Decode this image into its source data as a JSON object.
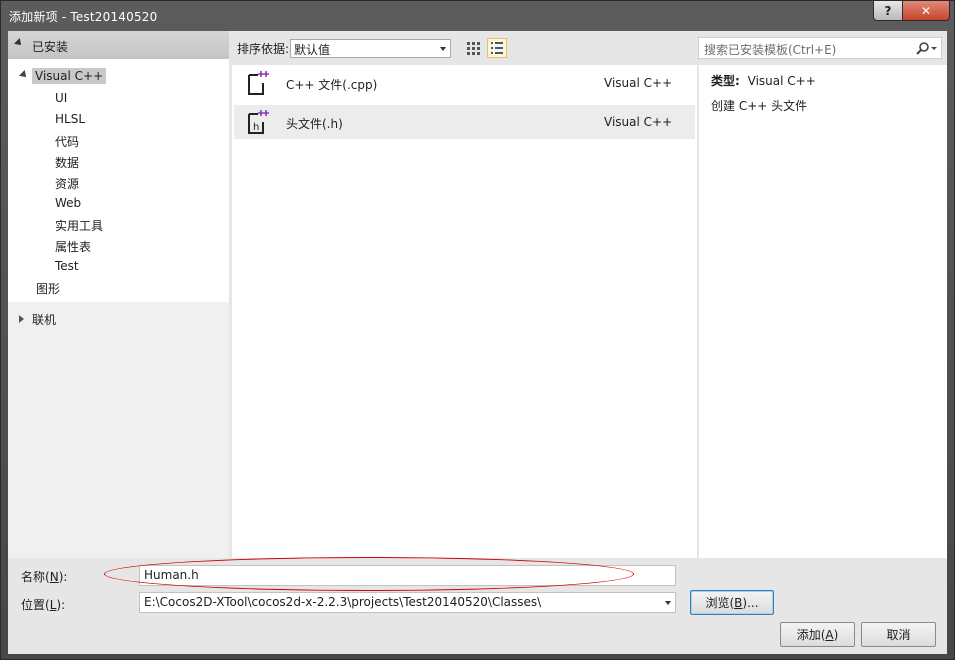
{
  "window": {
    "title": "添加新项 - Test20140520",
    "help_label": "?",
    "close_label": "✕"
  },
  "sidebar": {
    "header": "已安装",
    "root": "Visual C++",
    "children": [
      "UI",
      "HLSL",
      "代码",
      "数据",
      "资源",
      "Web",
      "实用工具",
      "属性表",
      "Test"
    ],
    "sibling": "图形",
    "online": "联机"
  },
  "toolbar": {
    "sort_label": "排序依据:",
    "sort_value": "默认值"
  },
  "templates": [
    {
      "name": "C++ 文件(.cpp)",
      "lang": "Visual C++"
    },
    {
      "name": "头文件(.h)",
      "lang": "Visual C++"
    }
  ],
  "search": {
    "placeholder": "搜索已安装模板(Ctrl+E)"
  },
  "details": {
    "type_label": "类型:",
    "type_value": "Visual C++",
    "description": "创建 C++ 头文件"
  },
  "form": {
    "name_label": "名称",
    "name_key": "N",
    "name_value": "Human.h",
    "location_label": "位置",
    "location_key": "L",
    "location_value": "E:\\Cocos2D-XTool\\cocos2d-x-2.2.3\\projects\\Test20140520\\Classes\\",
    "browse_label": "浏览",
    "browse_key": "B",
    "add_label": "添加",
    "add_key": "A",
    "cancel_label": "取消"
  },
  "colors": {
    "annotation": "#d40000",
    "selection": "#c9c9c9",
    "accent": "#3c7fb1"
  }
}
